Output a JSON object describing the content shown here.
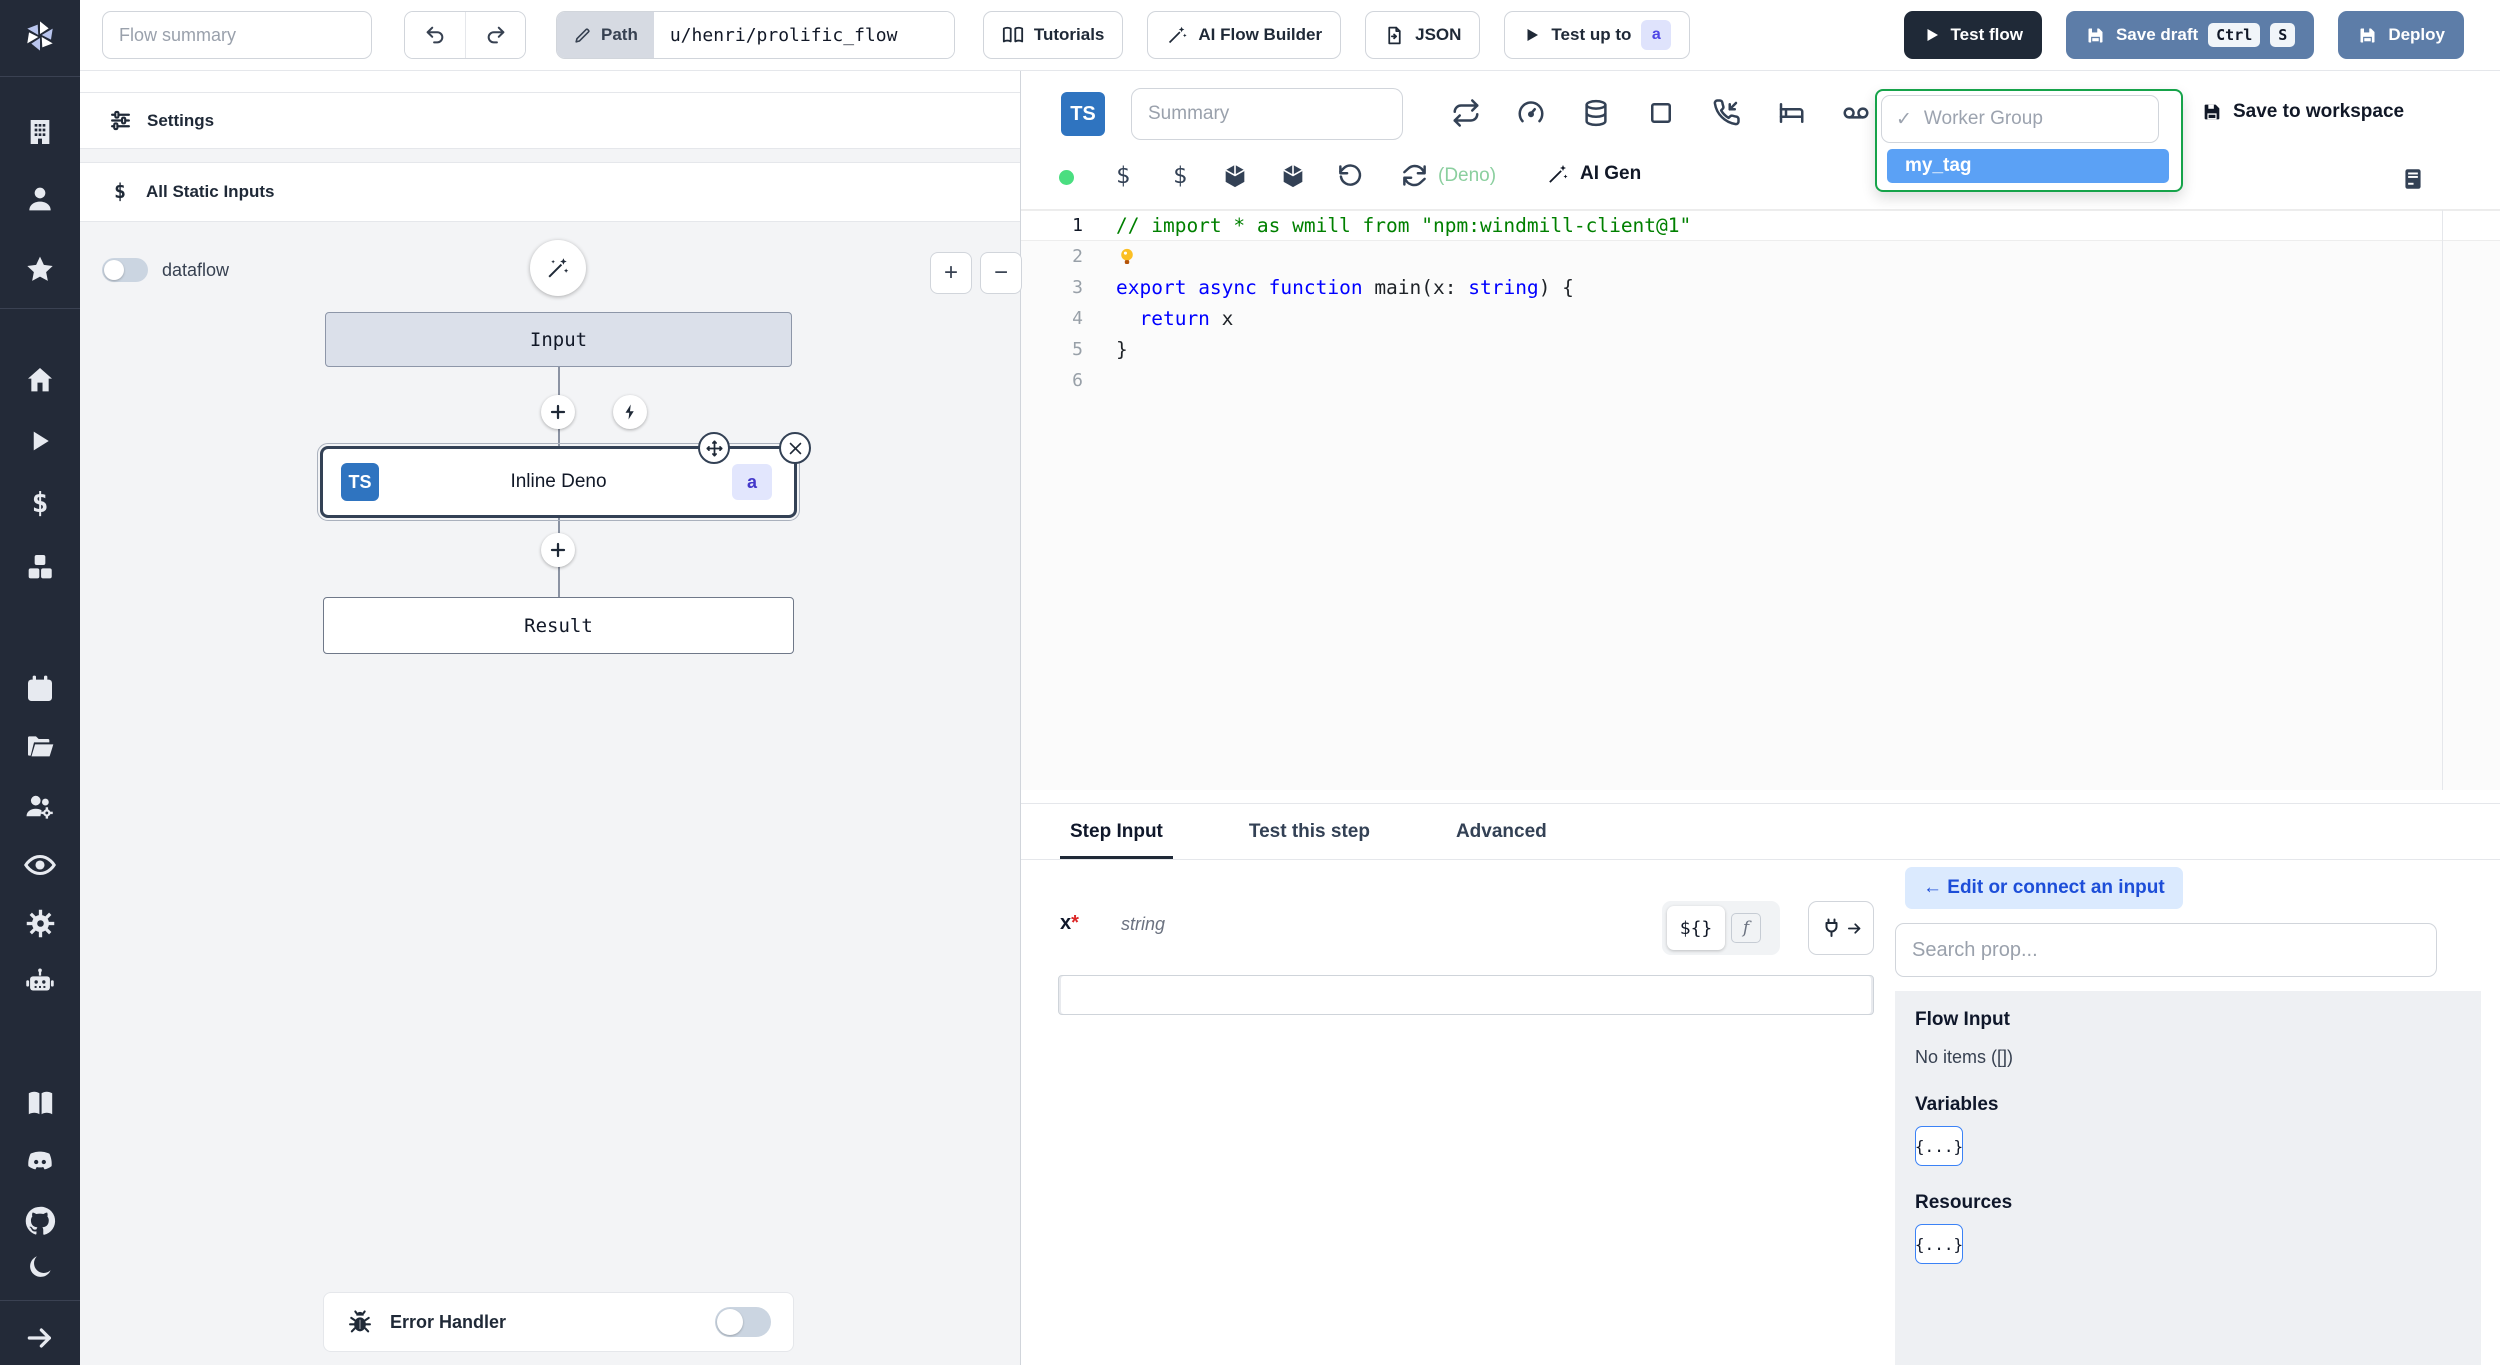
{
  "topbar": {
    "flow_summary_placeholder": "Flow summary",
    "path_label": "Path",
    "path_value": "u/henri/prolific_flow",
    "tutorials": "Tutorials",
    "ai_flow_builder": "AI Flow Builder",
    "json": "JSON",
    "test_up_to": "Test up to",
    "test_up_to_badge": "a",
    "test_flow": "Test flow",
    "save_draft": "Save draft",
    "kbd_ctrl": "Ctrl",
    "kbd_s": "S",
    "deploy": "Deploy"
  },
  "sidebar": {
    "icons": [
      "windmill-logo",
      "building",
      "user",
      "star",
      "home",
      "play",
      "dollar",
      "boxes",
      "calendar",
      "folder-open",
      "users-gear",
      "eye",
      "settings-gear",
      "robot",
      "book",
      "discord",
      "github",
      "moon",
      "arrow-right"
    ]
  },
  "flow_panel": {
    "settings": "Settings",
    "all_static_inputs": "All Static Inputs",
    "dataflow_label": "dataflow",
    "zoom_in": "+",
    "zoom_out": "−",
    "nodes": {
      "input": "Input",
      "step_label": "Inline Deno",
      "step_lang_badge": "TS",
      "step_id_badge": "a",
      "result": "Result"
    },
    "error_handler": "Error Handler"
  },
  "editor": {
    "lang_badge": "TS",
    "summary_placeholder": "Summary",
    "toolbar_icons": [
      "repeat",
      "gauge",
      "database",
      "square",
      "phone-incoming",
      "bed",
      "voicemail"
    ],
    "lang_toolbar_icons": [
      "status-dot",
      "dollar",
      "dollar",
      "package",
      "package",
      "rotate-ccw",
      "refresh-cw"
    ],
    "deno_label": "(Deno)",
    "ai_gen": "AI Gen",
    "save_to_workspace": "Save to workspace",
    "worker_group_dropdown": {
      "check": "✓",
      "label": "Worker Group",
      "selected_option": "my_tag",
      "border_color": "#16a34a",
      "option_highlight": "#5ba1f5"
    },
    "code": {
      "language": "TypeScript (Deno)",
      "lines": [
        [
          {
            "t": "// import * as wmill from \"npm:windmill-client@1\"",
            "c": "com"
          }
        ],
        [
          {
            "bulb": true
          }
        ],
        [
          {
            "t": "export ",
            "c": "kw"
          },
          {
            "t": "async ",
            "c": "kw"
          },
          {
            "t": "function ",
            "c": "kw"
          },
          {
            "t": "main(x: ",
            "c": "pl"
          },
          {
            "t": "string",
            "c": "ty"
          },
          {
            "t": ") {",
            "c": "pl"
          }
        ],
        [
          {
            "t": "  ",
            "c": "pl"
          },
          {
            "t": "return",
            "c": "kw"
          },
          {
            "t": " x",
            "c": "pl"
          }
        ],
        [
          {
            "t": "}",
            "c": "pl"
          }
        ],
        []
      ]
    }
  },
  "bottom": {
    "tabs": [
      "Step Input",
      "Test this step",
      "Advanced"
    ],
    "active_tab": "Step Input",
    "field": {
      "name": "x",
      "required_mark": "*",
      "type": "string",
      "value": ""
    },
    "toggle_template": "${}",
    "toggle_fn": "f",
    "connect_panel": {
      "edit_or_connect": "← Edit or connect an input",
      "search_placeholder": "Search prop...",
      "flow_input_title": "Flow Input",
      "flow_input_empty": "No items ([])",
      "variables_title": "Variables",
      "variables_button": "{...}",
      "resources_title": "Resources",
      "resources_button": "{...}"
    }
  },
  "colors": {
    "sidebar_bg": "#232a38",
    "primary_button": "#5d7da8",
    "dark_button": "#1f2937",
    "ts_badge": "#2f74c0",
    "badge_bg": "#e2e6fd",
    "badge_text": "#4338ca",
    "dropdown_border": "#16a34a",
    "option_highlight": "#5ba1f5",
    "status_dot": "#4ade80",
    "deno_green": "#8bcf9f"
  }
}
